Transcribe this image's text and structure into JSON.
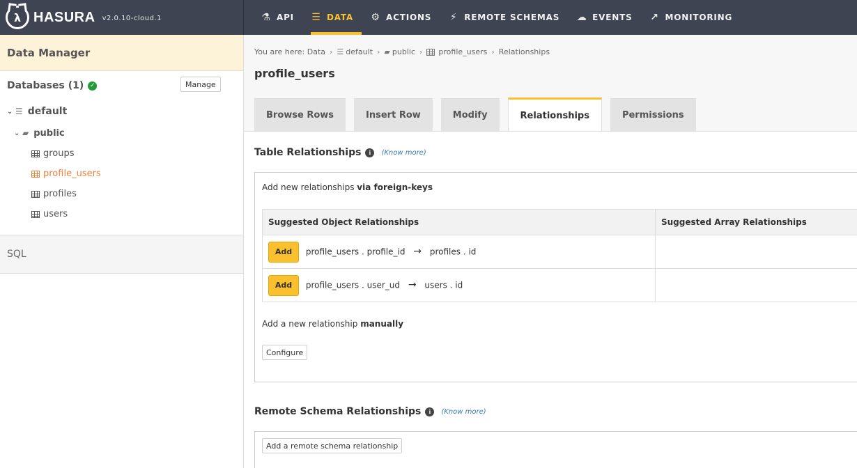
{
  "brand": {
    "logo_glyph": "λ",
    "name": "HASURA",
    "version": "v2.0.10-cloud.1"
  },
  "nav": [
    {
      "label": "API",
      "icon": "flask-icon"
    },
    {
      "label": "DATA",
      "icon": "database-icon",
      "active": true
    },
    {
      "label": "ACTIONS",
      "icon": "gears-icon"
    },
    {
      "label": "REMOTE SCHEMAS",
      "icon": "plug-icon"
    },
    {
      "label": "EVENTS",
      "icon": "cloud-icon"
    },
    {
      "label": "MONITORING",
      "icon": "chart-line-icon"
    }
  ],
  "sidebar": {
    "header": "Data Manager",
    "databases_label": "Databases (1)",
    "manage_label": "Manage",
    "database": "default",
    "schema": "public",
    "tables": [
      "groups",
      "profile_users",
      "profiles",
      "users"
    ],
    "active_table": "profile_users",
    "sql_label": "SQL"
  },
  "breadcrumb": {
    "prefix": "You are here:",
    "items": [
      "Data",
      "default",
      "public",
      "profile_users",
      "Relationships"
    ]
  },
  "page_title": "profile_users",
  "tabs": [
    "Browse Rows",
    "Insert Row",
    "Modify",
    "Relationships",
    "Permissions"
  ],
  "active_tab": "Relationships",
  "table_relationships": {
    "title": "Table Relationships",
    "know_more": "(Know more)",
    "fk_prefix": "Add new relationships",
    "fk_bold": "via foreign-keys",
    "col_object": "Suggested Object Relationships",
    "col_array": "Suggested Array Relationships",
    "add_label": "Add",
    "suggestions": [
      {
        "from": "profile_users . profile_id",
        "to": "profiles . id"
      },
      {
        "from": "profile_users . user_ud",
        "to": "users . id"
      }
    ],
    "manual_prefix": "Add a new relationship",
    "manual_bold": "manually",
    "configure_label": "Configure"
  },
  "remote_relationships": {
    "title": "Remote Schema Relationships",
    "know_more": "(Know more)",
    "add_label": "Add a remote schema relationship"
  },
  "colors": {
    "accent": "#fbc02d",
    "topbar": "#3e4452",
    "active_table": "#e8833a",
    "success": "#1f9d35"
  }
}
